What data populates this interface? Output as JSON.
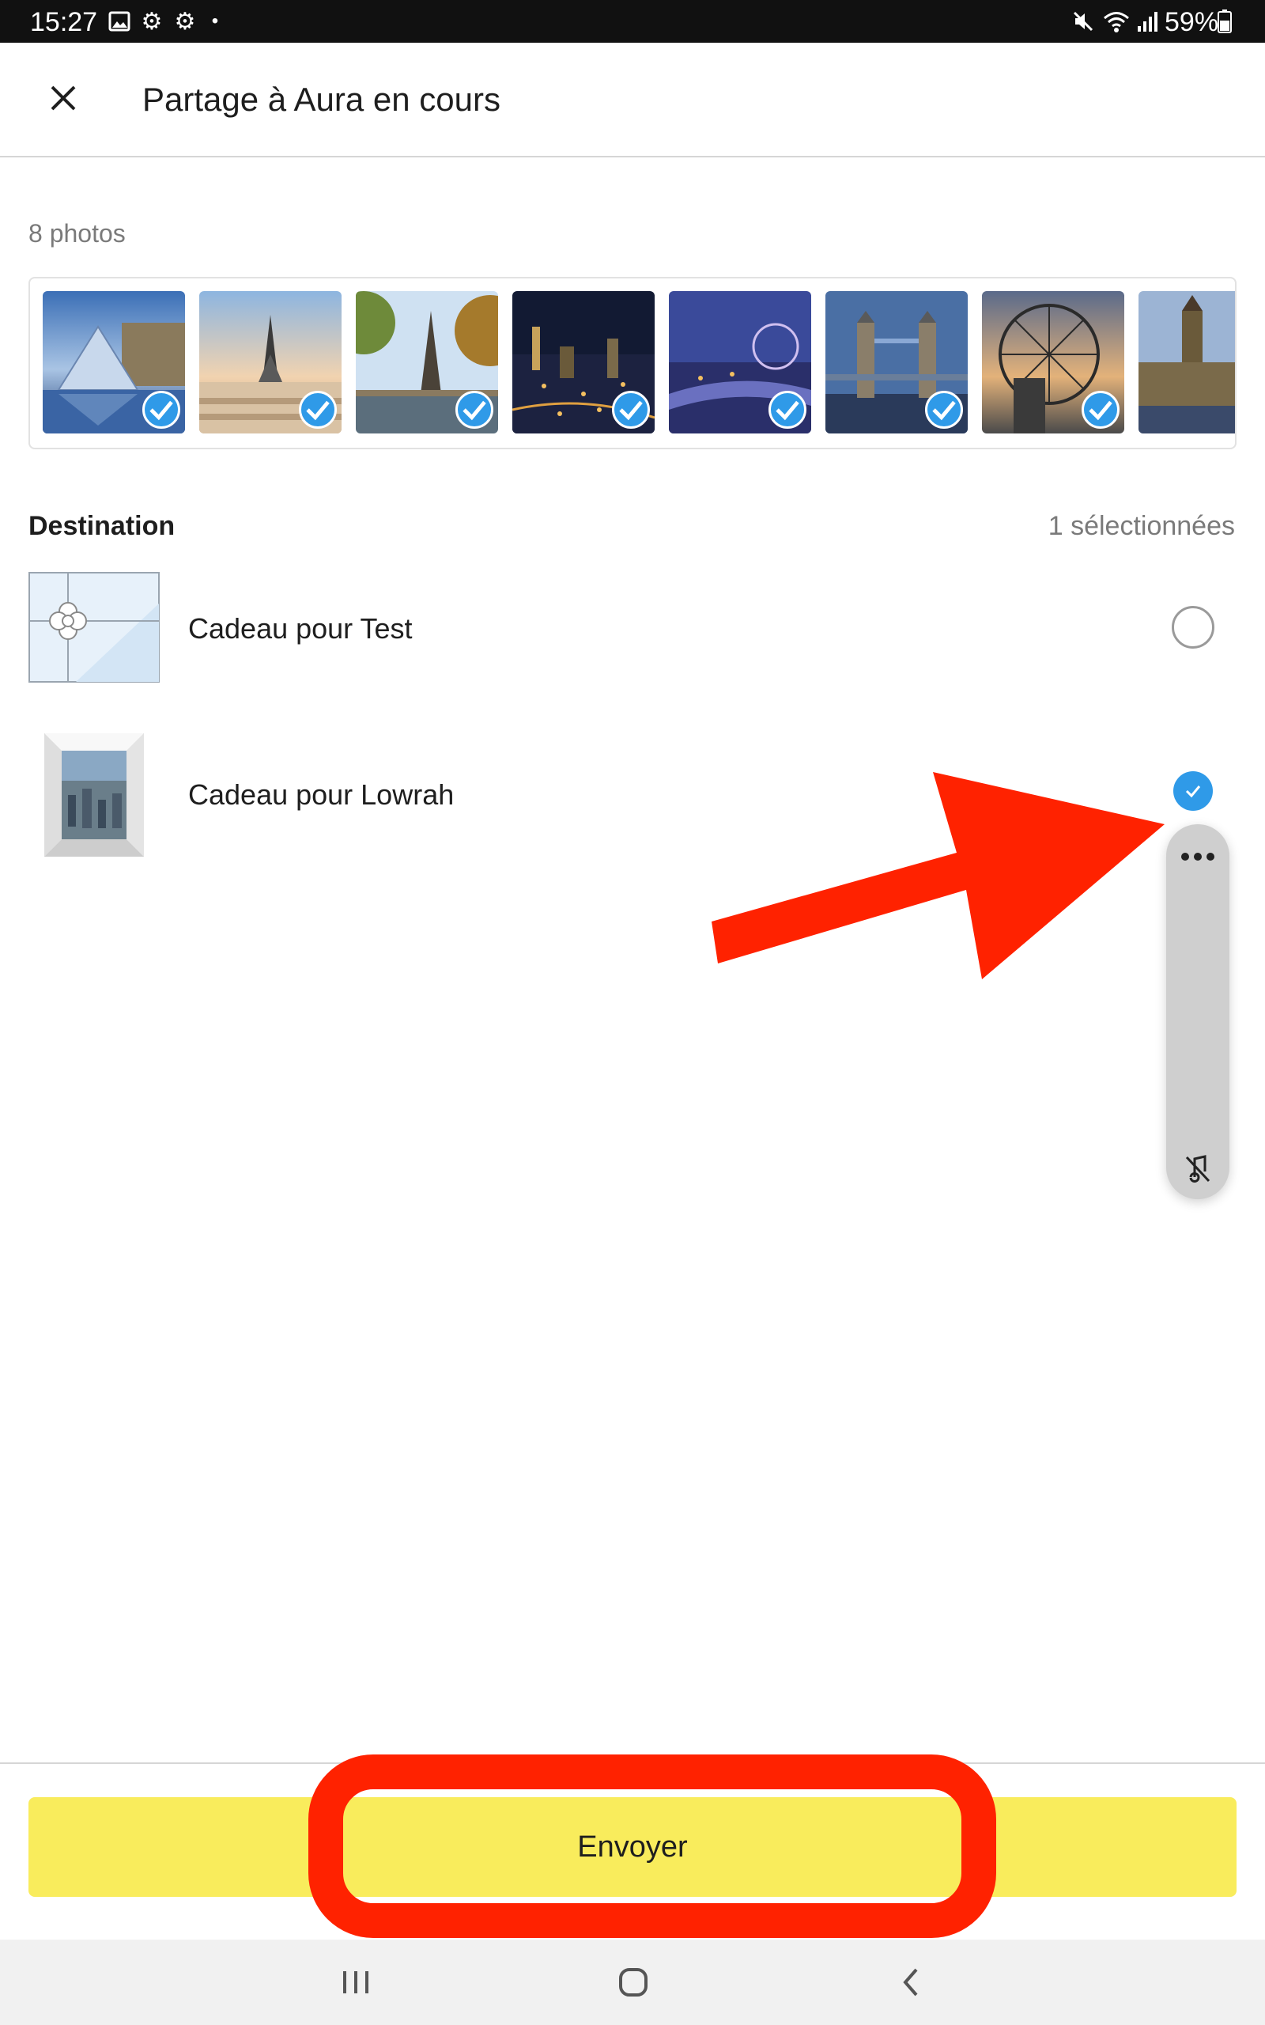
{
  "status_bar": {
    "time": "15:27",
    "battery": "59%",
    "icons": [
      "gallery-icon",
      "gear-icon",
      "gear-icon",
      "dot-icon",
      "mute-icon",
      "wifi-icon",
      "signal-icon",
      "battery-icon"
    ]
  },
  "header": {
    "title": "Partage à Aura en cours",
    "close_icon": "close-icon"
  },
  "photos": {
    "count_label": "8 photos",
    "items": [
      {
        "subject": "louvre-pyramid",
        "selected": true
      },
      {
        "subject": "eiffel-tower-trocadero",
        "selected": true
      },
      {
        "subject": "eiffel-tower-trees",
        "selected": true
      },
      {
        "subject": "london-night-skyline",
        "selected": true
      },
      {
        "subject": "london-eye-river-dusk",
        "selected": true
      },
      {
        "subject": "tower-bridge",
        "selected": true
      },
      {
        "subject": "london-eye-sunset",
        "selected": true
      },
      {
        "subject": "big-ben-westminster",
        "selected": true
      }
    ]
  },
  "destination": {
    "label": "Destination",
    "selected_count": "1 sélectionnées",
    "items": [
      {
        "name": "Cadeau pour Test",
        "selected": false,
        "thumbnail": "gift-wrap-icon"
      },
      {
        "name": "Cadeau pour Lowrah",
        "selected": true,
        "thumbnail": "framed-city-photo"
      }
    ]
  },
  "side_panel": {
    "icons": [
      "more-icon",
      "mute-icon"
    ]
  },
  "actions": {
    "send_label": "Envoyer"
  },
  "nav_bar": {
    "icons": [
      "recents-icon",
      "home-icon",
      "back-icon"
    ]
  },
  "colors": {
    "accent_blue": "#2f9ae8",
    "send_button": "#f9ec5c",
    "annotation_red": "#ff2200"
  }
}
